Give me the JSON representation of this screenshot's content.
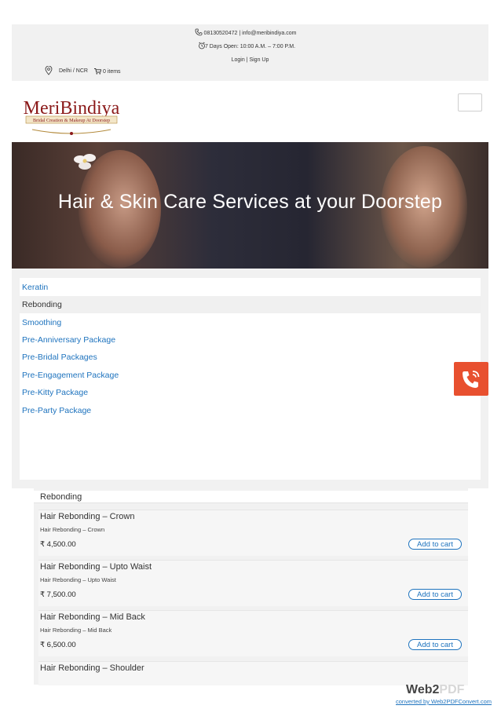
{
  "topbar": {
    "phone_line": "08130520472 | info@meribindiya.com",
    "hours_line": "7 Days Open: 10:00 A.M. – 7:00 P.M.",
    "login_line": "Login | Sign Up",
    "location": "Delhi / NCR",
    "cart_items": "0 items"
  },
  "brand": {
    "logo_name": "MeriBindiya",
    "logo_tagline": "Bridal Creation & Makeup At Doorstep",
    "logo_color": "#8b1a1a",
    "accent": "#1e73be",
    "call_button_color": "#e8502f"
  },
  "hero": {
    "title": "Hair & Skin Care Services at your Doorstep"
  },
  "categories": [
    {
      "label": "Keratin",
      "state": "link"
    },
    {
      "label": "Rebonding",
      "state": "active"
    },
    {
      "label": "Smoothing",
      "state": "link"
    },
    {
      "label": "Pre-Anniversary Package",
      "state": "link"
    },
    {
      "label": "Pre-Bridal Packages",
      "state": "link"
    },
    {
      "label": "Pre-Engagement Package",
      "state": "link"
    },
    {
      "label": "Pre-Kitty Package",
      "state": "link"
    },
    {
      "label": "Pre-Party Package",
      "state": "link"
    }
  ],
  "section": {
    "title": "Rebonding",
    "add_label": "Add to cart",
    "products": [
      {
        "name": "Hair Rebonding – Crown",
        "desc": "Hair Rebonding – Crown",
        "price": "₹ 4,500.00"
      },
      {
        "name": "Hair Rebonding – Upto Waist",
        "desc": "Hair Rebonding – Upto Waist",
        "price": "₹ 7,500.00"
      },
      {
        "name": "Hair Rebonding – Mid Back",
        "desc": "Hair Rebonding – Mid Back",
        "price": "₹ 6,500.00"
      },
      {
        "name": "Hair Rebonding – Shoulder",
        "desc": "",
        "price": ""
      }
    ]
  },
  "footer": {
    "web": "Web2",
    "pdf": "PDF",
    "converted_note": "converted by Web2PDFConvert.com"
  }
}
